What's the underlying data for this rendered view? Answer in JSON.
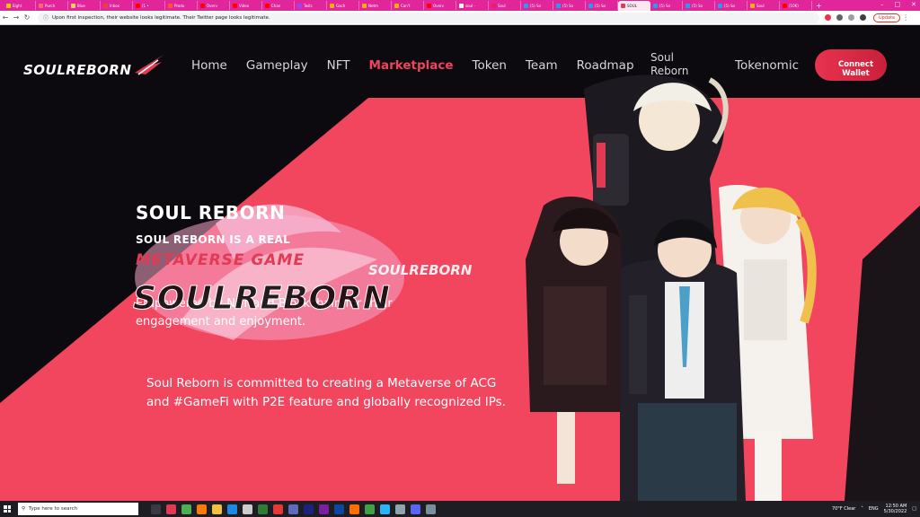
{
  "browser": {
    "tabs": [
      {
        "label": "Eight",
        "color": "#ffcc00"
      },
      {
        "label": "Purch",
        "color": "#ff6b6b"
      },
      {
        "label": "Blue",
        "color": "#ffd54f"
      },
      {
        "label": "Inbox",
        "color": "#ea4335"
      },
      {
        "label": "(1 •",
        "color": "#ff0000"
      },
      {
        "label": "Produ",
        "color": "#ff5722"
      },
      {
        "label": "Overv",
        "color": "#ff0000"
      },
      {
        "label": "Video",
        "color": "#ff0000"
      },
      {
        "label": "Chan",
        "color": "#ff0000"
      },
      {
        "label": "Twitc",
        "color": "#9146ff"
      },
      {
        "label": "Gach",
        "color": "#ffb300"
      },
      {
        "label": "Netm",
        "color": "#ffb300"
      },
      {
        "label": "Can't",
        "color": "#ffb300"
      },
      {
        "label": "Overv",
        "color": "#ff0000"
      },
      {
        "label": "soul -",
        "color": "#ffffff"
      },
      {
        "label": "Soul",
        "color": "#e91e63"
      },
      {
        "label": "(5) So",
        "color": "#1da1f2"
      },
      {
        "label": "(5) So",
        "color": "#1da1f2"
      },
      {
        "label": "(5) So",
        "color": "#1da1f2"
      },
      {
        "label": "SOUL",
        "color": "#e23a52",
        "active": true
      },
      {
        "label": "(5) So",
        "color": "#1da1f2"
      },
      {
        "label": "(5) So",
        "color": "#1da1f2"
      },
      {
        "label": "(5) So",
        "color": "#1da1f2"
      },
      {
        "label": "Soul",
        "color": "#ffb300"
      },
      {
        "label": "(10K)",
        "color": "#ff0000"
      }
    ],
    "new_tab": "+",
    "address": "Upon first inspection, their website looks legitimate. Their Twitter page looks legitimate.",
    "update_label": "Update"
  },
  "site": {
    "logo_text": "SOULREBORN",
    "nav": [
      {
        "label": "Home",
        "active": false
      },
      {
        "label": "Gameplay",
        "active": false
      },
      {
        "label": "NFT",
        "active": false
      },
      {
        "label": "Marketplace",
        "active": true
      },
      {
        "label": "Token",
        "active": false
      },
      {
        "label": "Team",
        "active": false
      },
      {
        "label": "Roadmap",
        "active": false
      }
    ],
    "nav_soul_line1": "Soul",
    "nav_soul_line2": "Reborn",
    "nav_tokenomic": "Tokenomic",
    "connect_line1": "Connect",
    "connect_line2": "Wallet",
    "hero_title": "SOUL REBORN",
    "hero_sub": "SOUL REBORN IS A REAL",
    "hero_sub2": "METAVERSE GAME",
    "hero_para": "Empowered by NFT and Blockchain for their engagement and enjoyment.",
    "overlay_logo": "SOULREBORN",
    "overlay_logo_small": "SOULREBORN",
    "description": "Soul Reborn is committed to creating a Metaverse of ACG and #GameFi with P2E feature and globally recognized IPs.",
    "accent_color": "#f0435f",
    "panel_color": "#f2465f"
  },
  "taskbar": {
    "search_placeholder": "Type here to search",
    "weather": "70°F  Clear",
    "lang": "ENG",
    "time": "12:50 AM",
    "date": "5/30/2022"
  }
}
